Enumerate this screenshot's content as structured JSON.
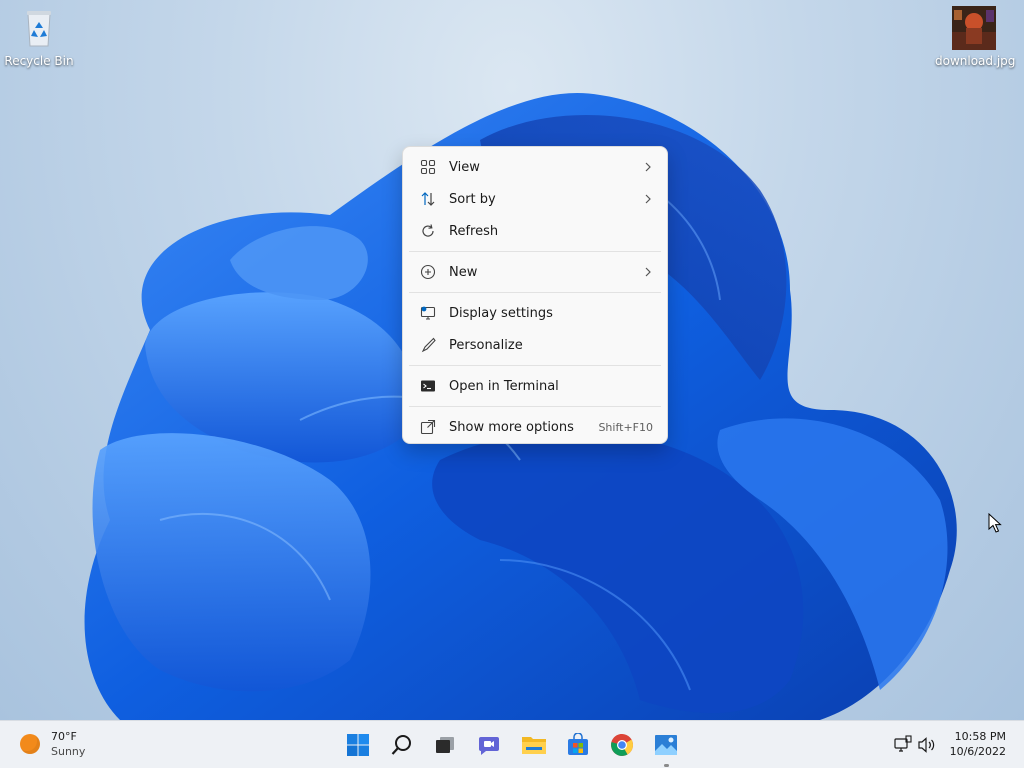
{
  "desktop": {
    "icons": [
      {
        "label": "Recycle Bin",
        "icon": "recycle-bin-icon"
      },
      {
        "label": "download.jpg",
        "icon": "image-thumbnail-icon"
      }
    ]
  },
  "context_menu": {
    "items": [
      {
        "label": "View",
        "icon": "grid-view-icon",
        "submenu": true
      },
      {
        "label": "Sort by",
        "icon": "sort-arrows-icon",
        "submenu": true
      },
      {
        "label": "Refresh",
        "icon": "refresh-icon",
        "submenu": false
      },
      {
        "label": "New",
        "icon": "plus-circle-icon",
        "submenu": true
      },
      {
        "label": "Display settings",
        "icon": "monitor-settings-icon",
        "submenu": false
      },
      {
        "label": "Personalize",
        "icon": "brush-icon",
        "submenu": false
      },
      {
        "label": "Open in Terminal",
        "icon": "terminal-icon",
        "submenu": false
      },
      {
        "label": "Show more options",
        "icon": "expand-icon",
        "shortcut": "Shift+F10"
      }
    ]
  },
  "taskbar": {
    "weather": {
      "temperature": "70°F",
      "condition": "Sunny"
    },
    "apps": [
      {
        "name": "Start",
        "icon": "windows-start-icon"
      },
      {
        "name": "Search",
        "icon": "search-icon"
      },
      {
        "name": "Task View",
        "icon": "task-view-icon"
      },
      {
        "name": "Chat",
        "icon": "chat-icon"
      },
      {
        "name": "File Explorer",
        "icon": "folder-icon"
      },
      {
        "name": "Microsoft Store",
        "icon": "store-icon"
      },
      {
        "name": "Chrome",
        "icon": "chrome-icon"
      },
      {
        "name": "Photos",
        "icon": "photos-icon"
      }
    ],
    "tray": {
      "icons": [
        "network-icon",
        "volume-icon"
      ]
    },
    "clock": {
      "time": "10:58 PM",
      "date": "10/6/2022"
    }
  },
  "colors": {
    "accent": "#0067c0",
    "wallpaper_blue": "#1565e6",
    "menu_background": "#f9f9f9",
    "taskbar_background": "#eef1f5"
  }
}
